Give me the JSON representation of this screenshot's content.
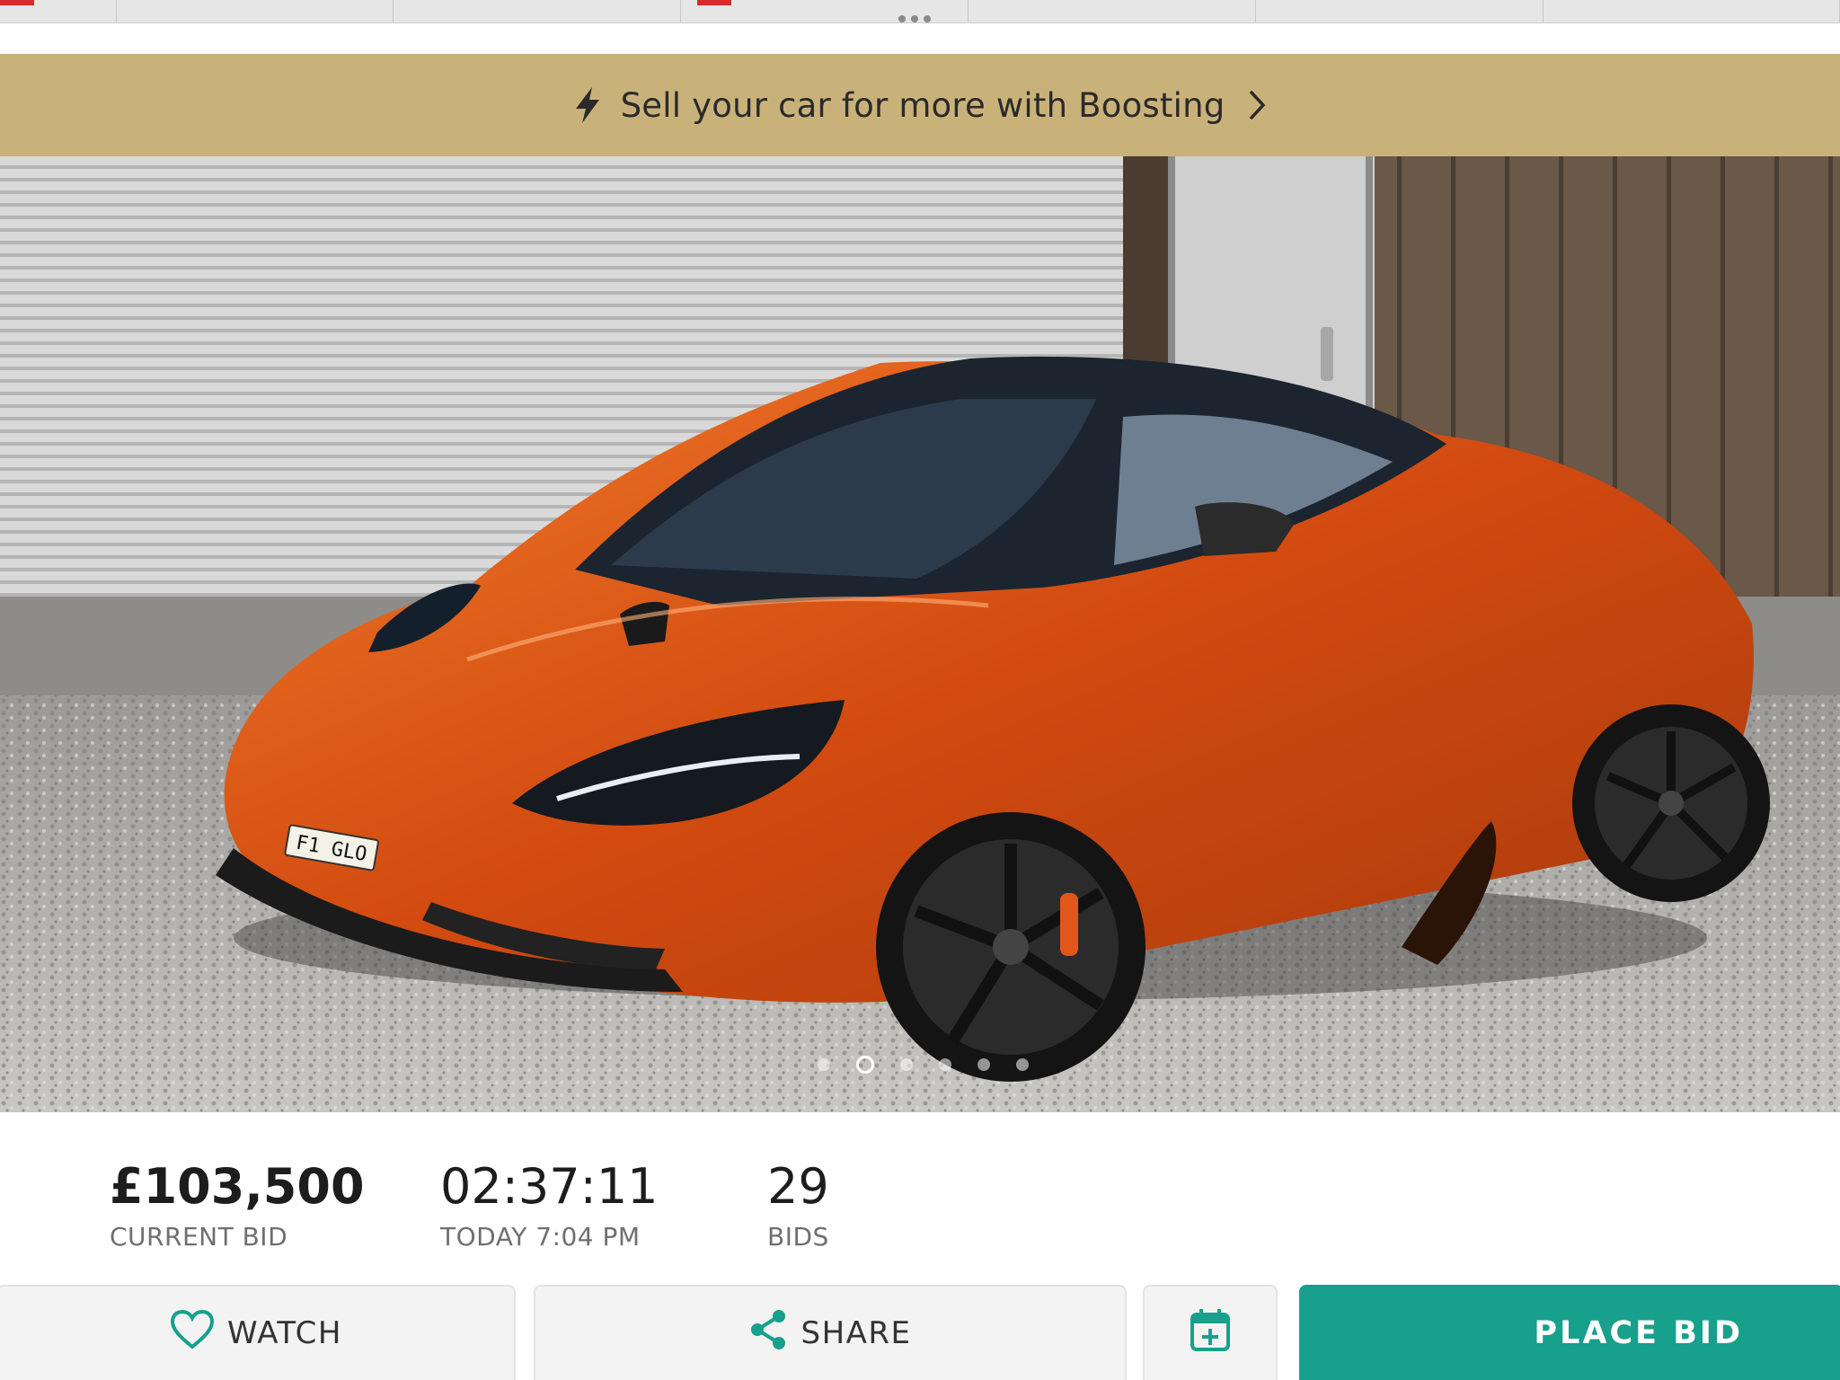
{
  "banner": {
    "text": "Sell your car for more with Boosting",
    "bg_color": "#c9b27a",
    "icon": "lightning-bolt-icon",
    "chevron": "chevron-right-icon"
  },
  "listing": {
    "photo_alt": "Orange McLaren 720S parked on gravel",
    "plate": "F1 GLO",
    "carousel_active_index": 1,
    "carousel_count": 6
  },
  "stats": {
    "current_bid": {
      "value": "£103,500",
      "label": "CURRENT BID"
    },
    "time_left": {
      "value": "02:37:11",
      "label": "TODAY 7:04 PM"
    },
    "bids": {
      "value": "29",
      "label": "BIDS"
    }
  },
  "actions": {
    "watch_label": "WATCH",
    "share_label": "SHARE",
    "place_bid_label": "PLACE BID",
    "accent_color": "#17a08c"
  }
}
